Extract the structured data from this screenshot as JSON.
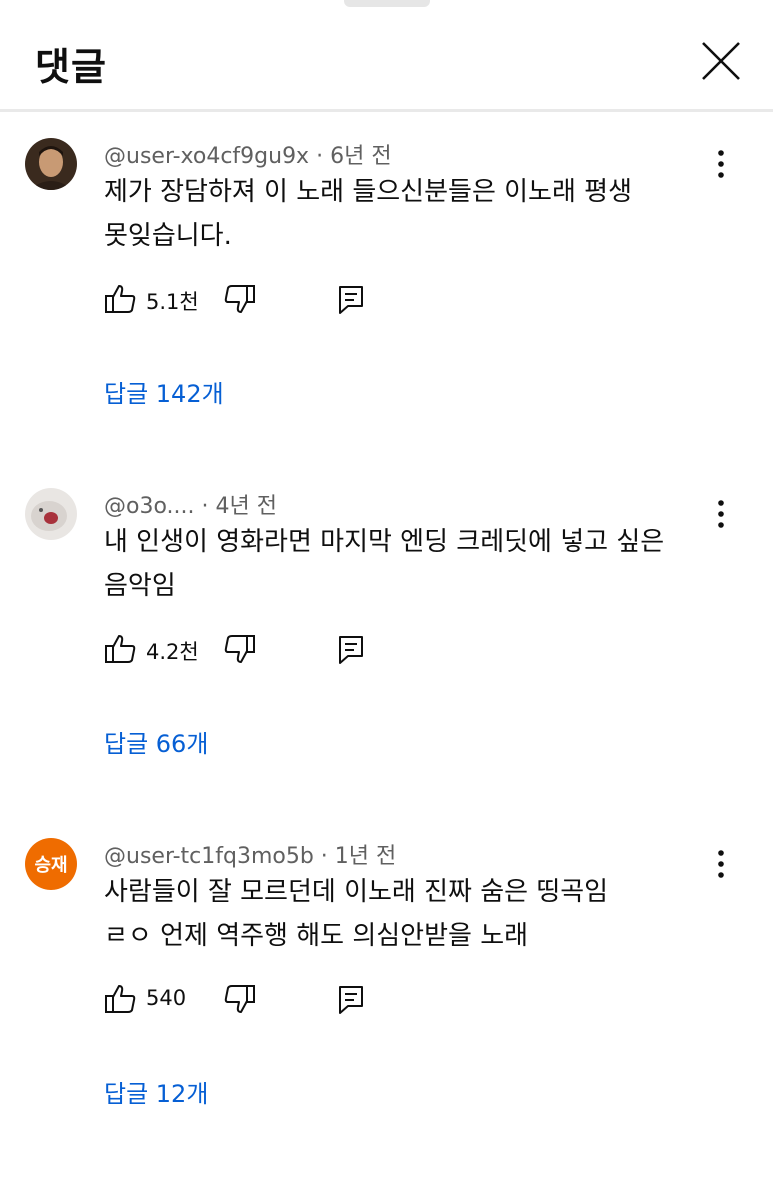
{
  "header": {
    "title": "댓글"
  },
  "comments": [
    {
      "handle": "@user-xo4cf9gu9x",
      "time": "6년 전",
      "lines": [
        "제가 장담하져 이 노래 들으신분들은 이노래 평생",
        "못잊습니다."
      ],
      "likes": "5.1천",
      "replies_label": "답글 142개",
      "avatar_letters": ""
    },
    {
      "handle": "@o3o....",
      "time": "4년 전",
      "lines": [
        "내 인생이 영화라면 마지막 엔딩 크레딧에 넣고 싶은",
        "음악임"
      ],
      "likes": "4.2천",
      "replies_label": "답글 66개",
      "avatar_letters": ""
    },
    {
      "handle": "@user-tc1fq3mo5b",
      "time": "1년 전",
      "lines": [
        "사람들이 잘 모르던데 이노래 진짜 숨은 띵곡임",
        "ㄹㅇ 언제 역주행 해도 의심안받을 노래"
      ],
      "likes": "540",
      "replies_label": "답글 12개",
      "avatar_letters": "승재"
    }
  ],
  "colors": {
    "link": "#065fd4",
    "meta": "#606060",
    "avatar_orange": "#ef6c00"
  },
  "icons": [
    "close-icon",
    "more-vert-icon",
    "thumb-up-icon",
    "thumb-down-icon",
    "reply-comment-icon"
  ]
}
